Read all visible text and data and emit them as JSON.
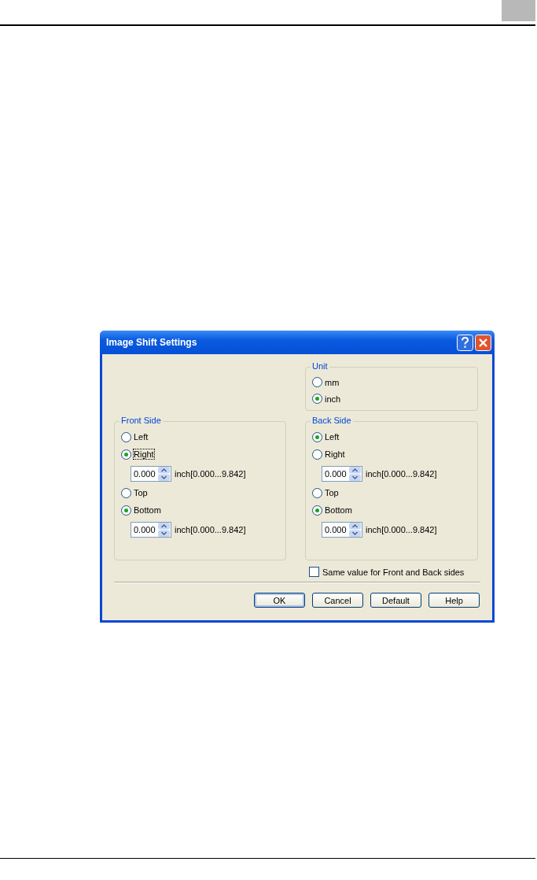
{
  "dialog": {
    "title": "Image Shift Settings",
    "unit": {
      "label": "Unit",
      "options": [
        {
          "label": "mm",
          "selected": false
        },
        {
          "label": "inch",
          "selected": true
        }
      ]
    },
    "groups": [
      {
        "label": "Front Side",
        "items": [
          {
            "kind": "radio",
            "label": "Left",
            "selected": false
          },
          {
            "kind": "radio",
            "label": "Right",
            "selected": true,
            "focused": true
          },
          {
            "kind": "spin",
            "value": "0.000",
            "range": "inch[0.000...9.842]"
          },
          {
            "kind": "radio",
            "label": "Top",
            "selected": false
          },
          {
            "kind": "radio",
            "label": "Bottom",
            "selected": true
          },
          {
            "kind": "spin",
            "value": "0.000",
            "range": "inch[0.000...9.842]"
          }
        ]
      },
      {
        "label": "Back Side",
        "items": [
          {
            "kind": "radio",
            "label": "Left",
            "selected": true
          },
          {
            "kind": "radio",
            "label": "Right",
            "selected": false
          },
          {
            "kind": "spin",
            "value": "0.000",
            "range": "inch[0.000...9.842]"
          },
          {
            "kind": "radio",
            "label": "Top",
            "selected": false
          },
          {
            "kind": "radio",
            "label": "Bottom",
            "selected": true
          },
          {
            "kind": "spin",
            "value": "0.000",
            "range": "inch[0.000...9.842]"
          }
        ]
      }
    ],
    "checkbox": {
      "label": "Same value for Front and Back sides",
      "checked": false
    },
    "buttons": [
      {
        "label": "OK",
        "default": true
      },
      {
        "label": "Cancel",
        "default": false
      },
      {
        "label": "Default",
        "default": false
      },
      {
        "label": "Help",
        "default": false
      }
    ]
  }
}
